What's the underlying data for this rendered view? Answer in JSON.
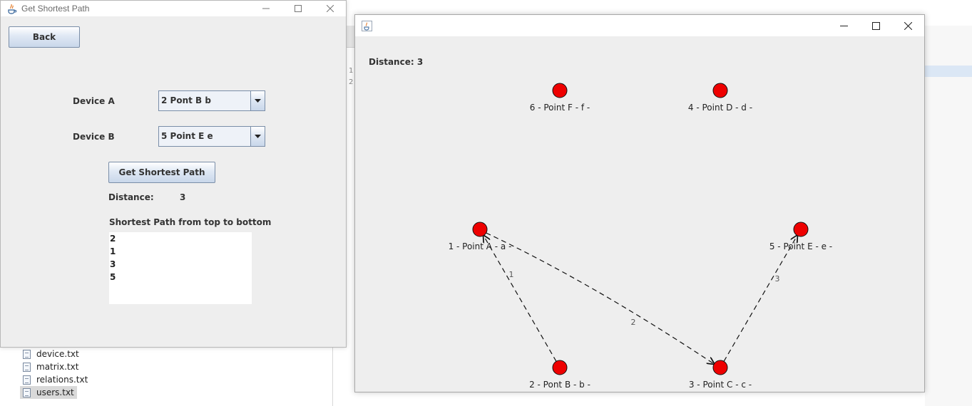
{
  "ide": {
    "files": [
      "device.txt",
      "matrix.txt",
      "relations.txt",
      "users.txt"
    ],
    "selected_file": "users.txt",
    "gutter_lines": [
      "1",
      "2"
    ]
  },
  "left_window": {
    "title": "Get Shortest Path",
    "back_label": "Back",
    "device_a_label": "Device A",
    "device_a_value": "2 Pont B b",
    "device_b_label": "Device B",
    "device_b_value": "5 Point E e",
    "get_path_label": "Get Shortest Path",
    "distance_label": "Distance:",
    "distance_value": "3",
    "path_heading": "Shortest Path from top to bottom",
    "path_items": [
      "2",
      "1",
      "3",
      "5"
    ]
  },
  "right_window": {
    "title": "",
    "distance_text": "Distance: 3"
  },
  "graph": {
    "node_color": "#ee0000",
    "nodes": [
      {
        "id": "6",
        "label": "6 - Point F - f -"
      },
      {
        "id": "4",
        "label": "4 - Point D - d -"
      },
      {
        "id": "1",
        "label": "1 - Point A - a -"
      },
      {
        "id": "5",
        "label": "5 - Point E - e -"
      },
      {
        "id": "2",
        "label": "2 - Pont B - b -"
      },
      {
        "id": "3",
        "label": "3 - Point C - c -"
      }
    ],
    "edges": [
      {
        "from": "2",
        "to": "1",
        "weight": "1"
      },
      {
        "from": "1",
        "to": "3",
        "weight": "2"
      },
      {
        "from": "3",
        "to": "5",
        "weight": "3"
      }
    ]
  }
}
